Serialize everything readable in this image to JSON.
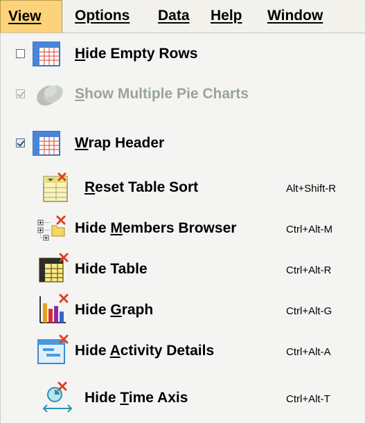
{
  "menubar": {
    "items": [
      {
        "label": "View",
        "active": true
      },
      {
        "label": "Options"
      },
      {
        "label": "Data"
      },
      {
        "label": "Help"
      },
      {
        "label": "Window"
      }
    ]
  },
  "view_menu": {
    "items": [
      {
        "label_pre": "",
        "mnemonic": "H",
        "label_post": "ide Empty Rows",
        "shortcut": "",
        "checkbox": "unchecked",
        "enabled": true,
        "icon": "table-grid-icon"
      },
      {
        "label_pre": "",
        "mnemonic": "S",
        "label_post": "how Multiple Pie Charts",
        "shortcut": "",
        "checkbox": "checked",
        "enabled": false,
        "icon": "pie-chart-icon"
      },
      {
        "label_pre": "",
        "mnemonic": "W",
        "label_post": "rap Header",
        "shortcut": "",
        "checkbox": "checked",
        "enabled": true,
        "icon": "table-grid-icon"
      },
      {
        "label_pre": "",
        "mnemonic": "R",
        "label_post": "eset Table Sort",
        "shortcut": "Alt+Shift-R",
        "checkbox": "none",
        "enabled": true,
        "icon": "reset-sort-icon"
      },
      {
        "label_pre": "Hide ",
        "mnemonic": "M",
        "label_post": "embers Browser",
        "shortcut": "Ctrl+Alt-M",
        "checkbox": "none",
        "enabled": true,
        "icon": "members-tree-icon"
      },
      {
        "label_pre": "Hide Table",
        "mnemonic": "",
        "label_post": "",
        "shortcut": "Ctrl+Alt-R",
        "checkbox": "none",
        "enabled": true,
        "icon": "table-hide-icon"
      },
      {
        "label_pre": "Hide ",
        "mnemonic": "G",
        "label_post": "raph",
        "shortcut": "Ctrl+Alt-G",
        "checkbox": "none",
        "enabled": true,
        "icon": "bar-graph-icon"
      },
      {
        "label_pre": "Hide ",
        "mnemonic": "A",
        "label_post": "ctivity Details",
        "shortcut": "Ctrl+Alt-A",
        "checkbox": "none",
        "enabled": true,
        "icon": "activity-details-icon"
      },
      {
        "label_pre": "Hide ",
        "mnemonic": "T",
        "label_post": "ime Axis",
        "shortcut": "Ctrl+Alt-T",
        "checkbox": "none",
        "enabled": true,
        "icon": "time-axis-icon"
      }
    ]
  },
  "colors": {
    "menubar_bg": "#f2f1ec",
    "active_menu_bg": "#fcd27a",
    "dropdown_bg": "#f4f4f2",
    "disabled_text": "#98a596",
    "red_x": "#e04020"
  }
}
